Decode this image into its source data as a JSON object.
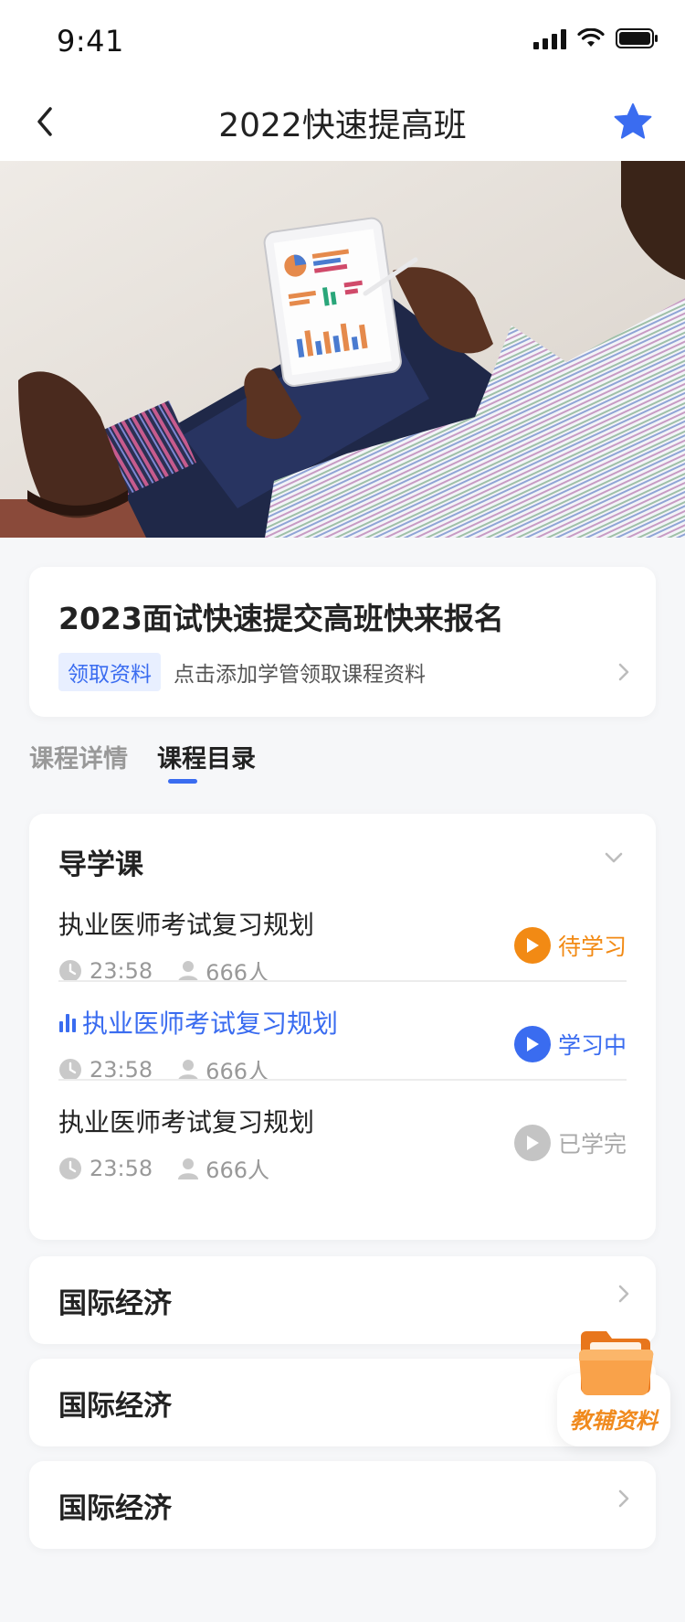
{
  "status_bar": {
    "time": "9:41"
  },
  "nav": {
    "title": "2022快速提高班",
    "favorite_color": "#3a6cf0"
  },
  "info_card": {
    "title": "2023面试快速提交高班快来报名",
    "tag": "领取资料",
    "text": "点击添加学管领取课程资料"
  },
  "tabs": [
    {
      "label": "课程详情",
      "active": false
    },
    {
      "label": "课程目录",
      "active": true
    }
  ],
  "chapter": {
    "title": "导学课",
    "lessons": [
      {
        "name": "执业医师考试复习规划",
        "duration": "23:58",
        "learners": "666人",
        "status": "待学习",
        "status_color": "#f28a14"
      },
      {
        "name": "执业医师考试复习规划",
        "duration": "23:58",
        "learners": "666人",
        "status": "学习中",
        "status_color": "#3a6cf0"
      },
      {
        "name": "执业医师考试复习规划",
        "duration": "23:58",
        "learners": "666人",
        "status": "已学完",
        "status_color": "#bbbbbb"
      }
    ]
  },
  "sections": [
    {
      "title": "国际经济"
    },
    {
      "title": "国际经济"
    },
    {
      "title": "国际经济"
    }
  ],
  "float_button": {
    "label": "教辅资料"
  },
  "colors": {
    "accent": "#3a6cf0",
    "orange": "#f28a14",
    "grey": "#bbbbbb"
  }
}
